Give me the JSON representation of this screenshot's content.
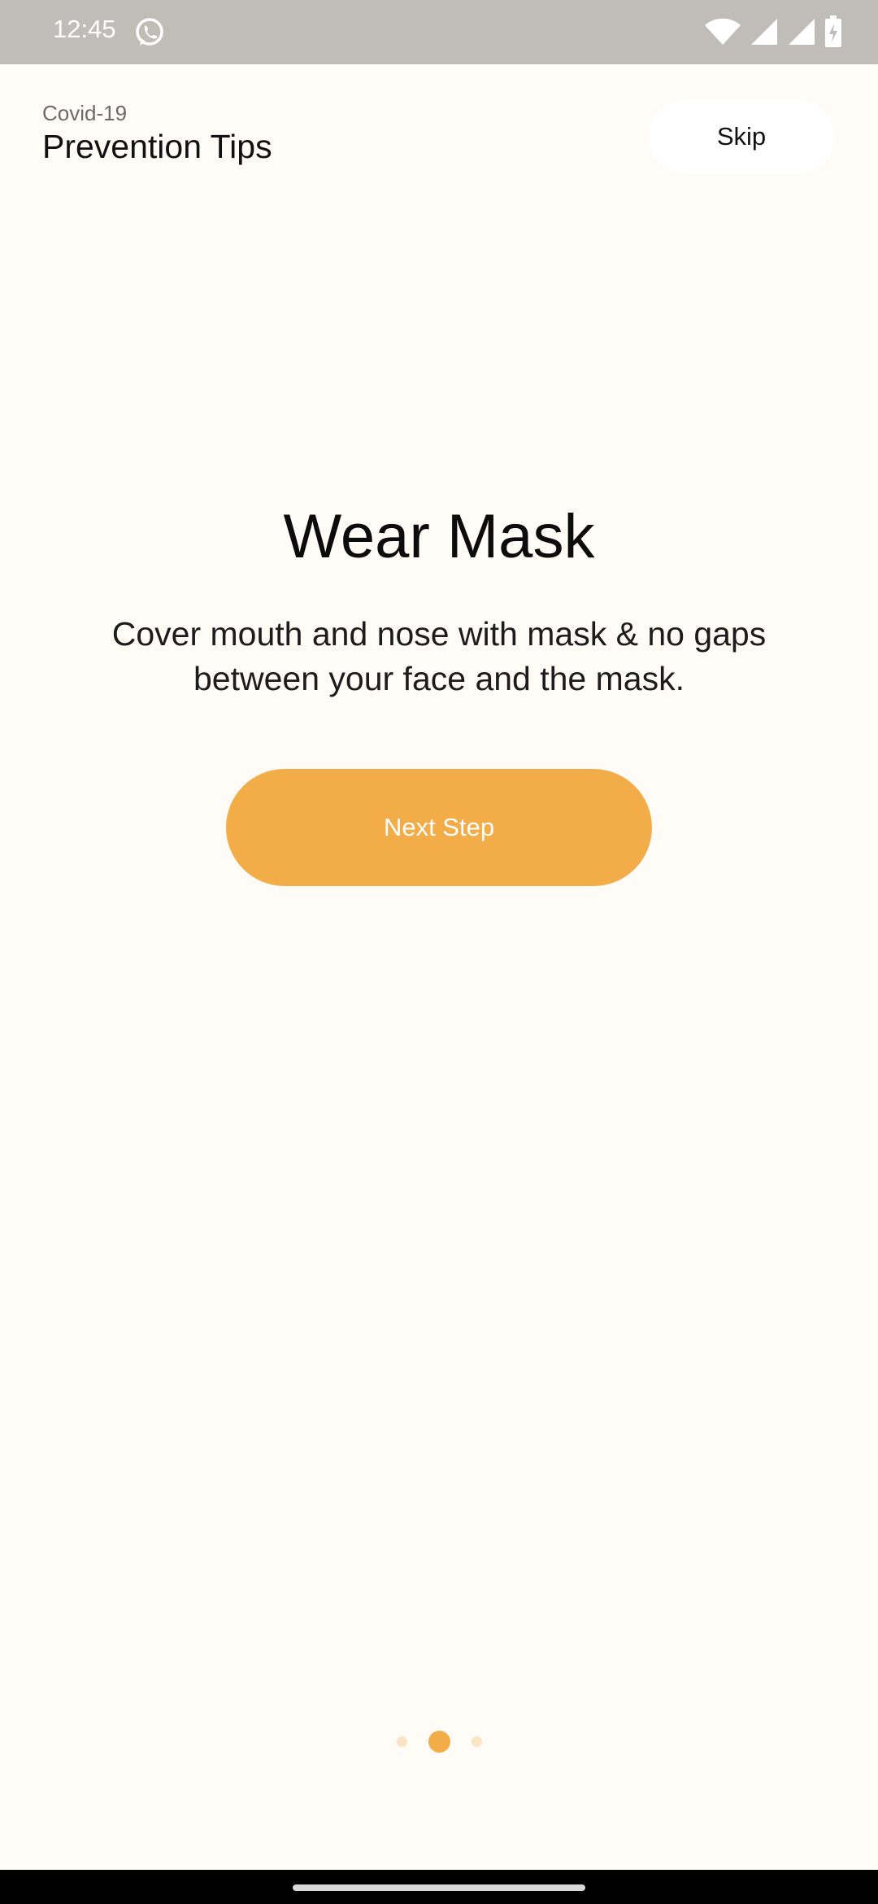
{
  "status_bar": {
    "time": "12:45",
    "icons": [
      "whatsapp-icon",
      "wifi-icon",
      "cell-signal-icon",
      "cell-signal-icon",
      "battery-icon"
    ]
  },
  "header": {
    "subtitle": "Covid-19",
    "title": "Prevention Tips",
    "skip_label": "Skip"
  },
  "content": {
    "title": "Wear Mask",
    "description": "Cover mouth and nose with mask & no gaps between your face and the mask.",
    "next_label": "Next Step"
  },
  "pager": {
    "total_pages": 3,
    "current_page": 2
  },
  "colors": {
    "accent": "#f3ad48",
    "background": "#fffcf8",
    "status_bar": "#c0bdb8"
  }
}
